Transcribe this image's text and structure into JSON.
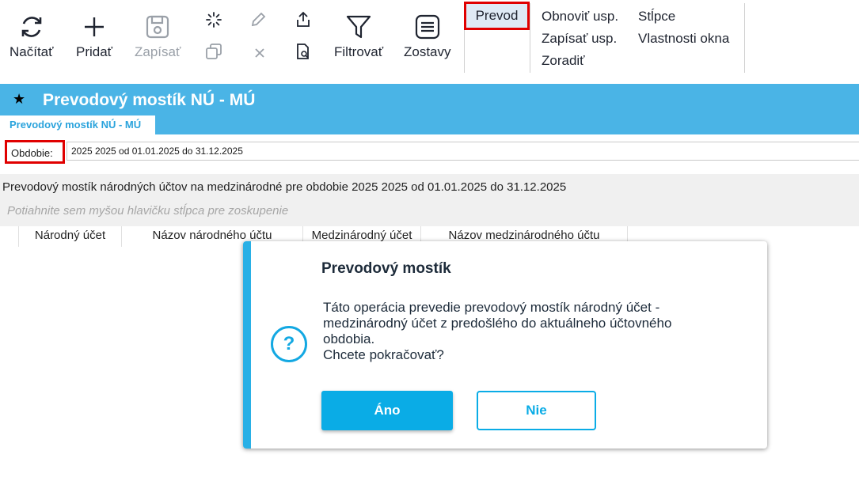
{
  "toolbar": {
    "nacitat": "Načítať",
    "pridat": "Pridať",
    "zapisat": "Zapísať",
    "filtrovat": "Filtrovať",
    "zostavy": "Zostavy",
    "prevod": "Prevod",
    "obnovit_usp": "Obnoviť usp.",
    "zapisat_usp": "Zapísať usp.",
    "zoradit": "Zoradiť",
    "stlpce": "Stĺpce",
    "vlastnosti_okna": "Vlastnosti okna"
  },
  "window": {
    "title": "Prevodový mostík NÚ - MÚ",
    "tab": "Prevodový mostík NÚ - MÚ"
  },
  "obdobie": {
    "label": "Obdobie:",
    "value": "2025 2025 od 01.01.2025 do 31.12.2025"
  },
  "grid": {
    "caption": "Prevodový mostík národných účtov na medzinárodné pre obdobie 2025 2025 od 01.01.2025 do 31.12.2025",
    "group_hint": "Potiahnite sem myšou hlavičku stĺpca pre zoskupenie",
    "columns": [
      "Národný účet",
      "Názov národného účtu",
      "Medzinárodný účet",
      "Názov medzinárodného účtu"
    ]
  },
  "dialog": {
    "title": "Prevodový mostík",
    "message": "Táto operácia prevedie prevodový mostík národný účet -\nmedzinárodný účet z predošlého do aktuálneho účtovného\nobdobia.\n Chcete pokračovať?",
    "icon_glyph": "?",
    "yes": "Áno",
    "no": "Nie"
  },
  "colors": {
    "accent": "#4ab4e6",
    "button_primary": "#0aace6",
    "highlight_border": "#e00000"
  }
}
